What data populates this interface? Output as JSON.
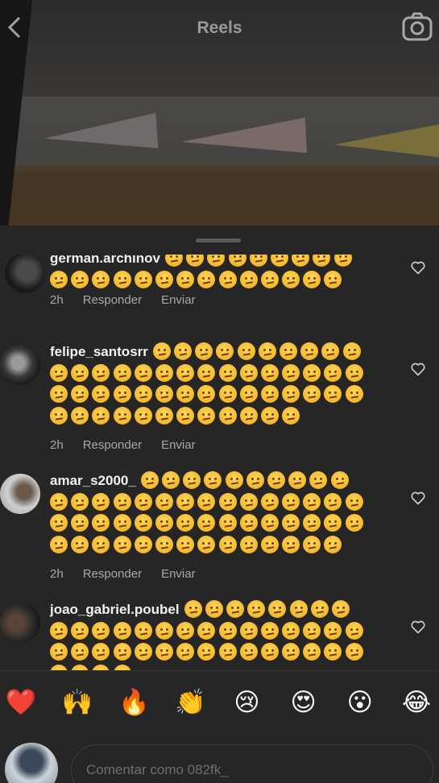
{
  "header": {
    "title": "Reels"
  },
  "comments": [
    {
      "username": "german.archinov",
      "line1_emoji_count": 9,
      "emoji_rows": [
        14
      ],
      "time": "2h",
      "reply": "Responder",
      "send": "Enviar"
    },
    {
      "username": "felipe_santosrr",
      "line1_emoji_count": 10,
      "emoji_rows": [
        15,
        15,
        12
      ],
      "time": "2h",
      "reply": "Responder",
      "send": "Enviar"
    },
    {
      "username": "amar_s2000_",
      "line1_emoji_count": 10,
      "emoji_rows": [
        15,
        15,
        14
      ],
      "time": "2h",
      "reply": "Responder",
      "send": "Enviar"
    },
    {
      "username": "joao_gabriel.poubel",
      "line1_emoji_count": 8,
      "emoji_rows": [
        15,
        15,
        4
      ]
    }
  ],
  "reactions": [
    "❤️",
    "🙌",
    "🔥",
    "👏",
    "😢",
    "😍",
    "😮",
    "😂"
  ],
  "composer": {
    "placeholder": "Comentar como 082fk_"
  },
  "icons": {
    "back": "chevron-left-icon",
    "camera": "camera-icon",
    "like": "heart-outline-icon"
  },
  "emoji_used": "face-with-raised-eyebrow"
}
